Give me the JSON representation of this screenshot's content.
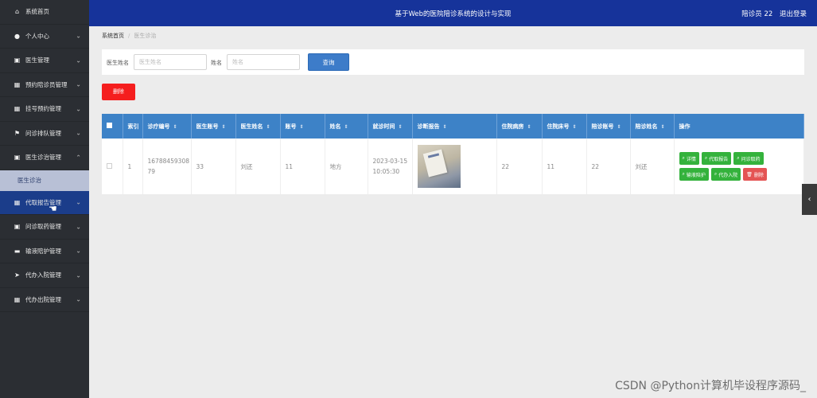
{
  "sidebar": {
    "items": [
      {
        "label": "系统首页",
        "icon": "home-icon",
        "glyph": "⌂",
        "chevron": false
      },
      {
        "label": "个人中心",
        "icon": "user-icon",
        "glyph": "●",
        "chevron": true
      },
      {
        "label": "医生管理",
        "icon": "doc-icon",
        "glyph": "▣",
        "chevron": true
      },
      {
        "label": "预约陪诊员管理",
        "icon": "grid-icon",
        "glyph": "▦",
        "chevron": true
      },
      {
        "label": "挂号预约管理",
        "icon": "grid-icon",
        "glyph": "▦",
        "chevron": true
      },
      {
        "label": "问诊排队管理",
        "icon": "flag-icon",
        "glyph": "⚑",
        "chevron": true
      },
      {
        "label": "医生诊治管理",
        "icon": "doc-icon",
        "glyph": "▣",
        "chevron": true,
        "expanded": true
      }
    ],
    "subitem": "医生诊治",
    "items2": [
      {
        "label": "代取报告管理",
        "icon": "grid-icon",
        "glyph": "▦",
        "chevron": true,
        "active": true
      },
      {
        "label": "问诊取药管理",
        "icon": "doc-icon",
        "glyph": "▣",
        "chevron": true
      },
      {
        "label": "输液陪护管理",
        "icon": "briefcase-icon",
        "glyph": "▬",
        "chevron": true
      },
      {
        "label": "代办入院管理",
        "icon": "send-icon",
        "glyph": "➤",
        "chevron": true
      },
      {
        "label": "代办出院管理",
        "icon": "grid-icon",
        "glyph": "▦",
        "chevron": true
      }
    ]
  },
  "header": {
    "title": "基于Web的医院陪诊系统的设计与实现",
    "user": "陪诊员 22",
    "logout": "退出登录"
  },
  "breadcrumb": {
    "home": "系统首页",
    "current": "医生诊治"
  },
  "search": {
    "doctor_name_label": "医生姓名",
    "doctor_name_placeholder": "医生姓名",
    "name_label": "姓名",
    "name_placeholder": "姓名",
    "query_button": "查询"
  },
  "delete_button": "删除",
  "table": {
    "headers": [
      "索引",
      "诊疗编号",
      "医生账号",
      "医生姓名",
      "账号",
      "姓名",
      "就诊时间",
      "诊断报告",
      "住院病房",
      "住院床号",
      "陪诊账号",
      "陪诊姓名",
      "操作"
    ],
    "row": {
      "index": "1",
      "visit_no": "1678845930879",
      "doctor_account": "33",
      "doctor_name": "刘还",
      "account": "11",
      "name": "地方",
      "visit_date": "2023-03-15",
      "visit_time": "10:05:30",
      "ward": "22",
      "bed": "11",
      "escort_account": "22",
      "escort_name": "刘还"
    },
    "actions": [
      "详情",
      "代取报告",
      "问诊取药",
      "输液陪护",
      "代办入院",
      "删除"
    ]
  },
  "watermark": "CSDN @Python计算机毕设程序源码_",
  "colors": {
    "sidebar": "#2b2e33",
    "header": "#16339a",
    "table_header": "#3d82c7",
    "action_green": "#34b23c",
    "danger": "#f51e1e"
  }
}
